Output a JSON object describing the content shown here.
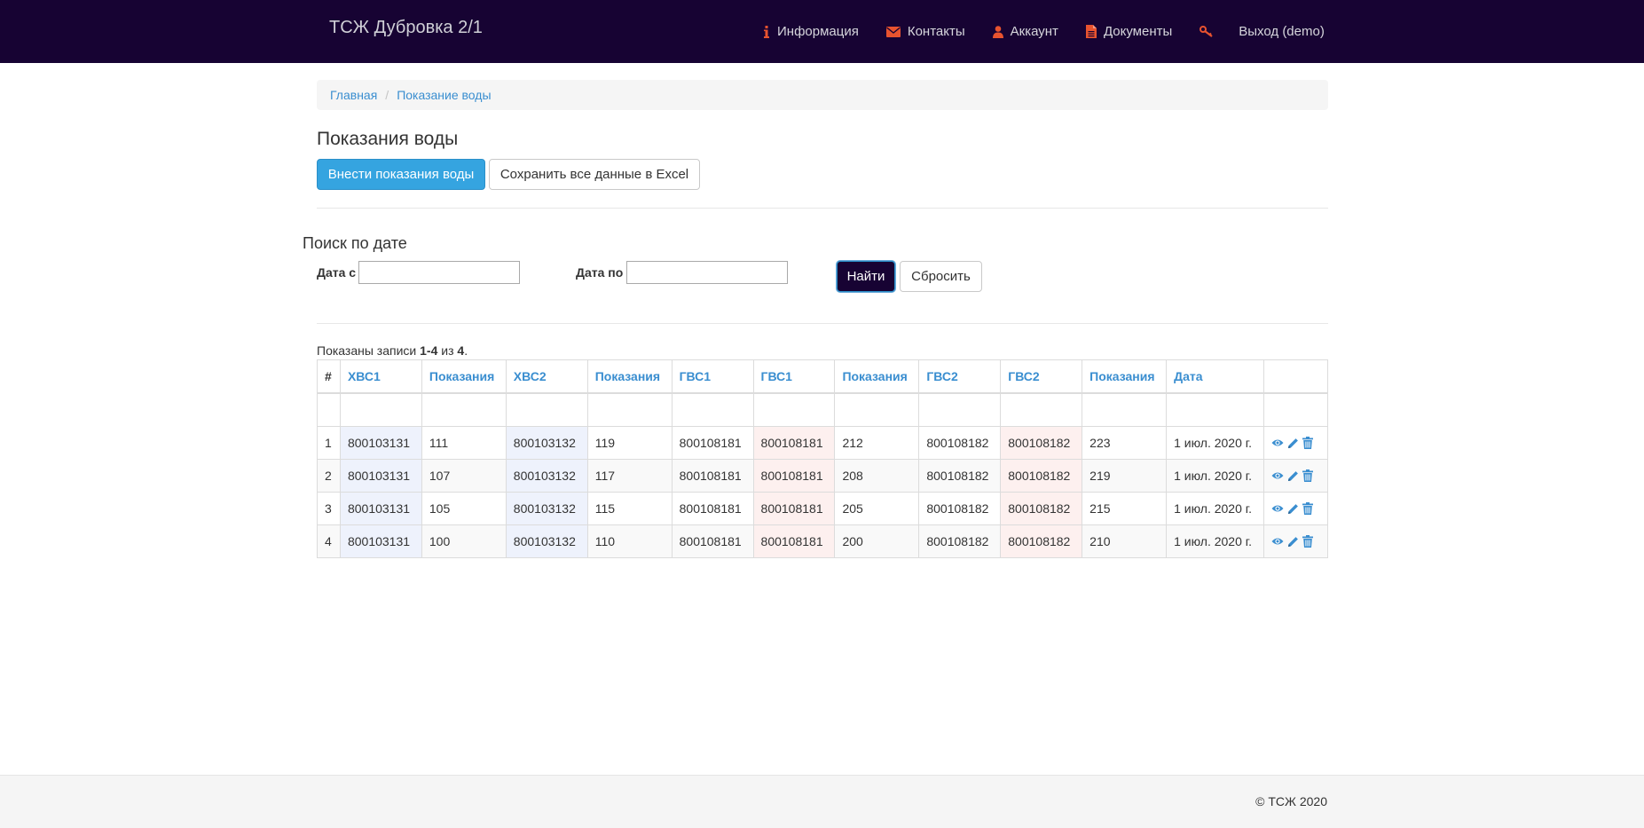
{
  "navbar": {
    "brand": "ТСЖ Дубровка 2/1",
    "items": [
      {
        "label": "Информация",
        "icon": "info-icon"
      },
      {
        "label": "Контакты",
        "icon": "envelope-icon"
      },
      {
        "label": "Аккаунт",
        "icon": "user-icon"
      },
      {
        "label": "Документы",
        "icon": "document-icon"
      },
      {
        "label": "",
        "icon": "key-icon"
      },
      {
        "label": "Выход (demo)",
        "icon": ""
      }
    ],
    "accent_color": "#e8532f",
    "background": "#170333"
  },
  "breadcrumb": {
    "home": "Главная",
    "current": "Показание воды",
    "separator": "/"
  },
  "page": {
    "title": "Показания воды",
    "add_button": "Внести показания воды",
    "export_button": "Сохранить все данные в Excel"
  },
  "search": {
    "title": "Поиск по дате",
    "date_from_label": "Дата с",
    "date_from_value": "",
    "date_to_label": "Дата по",
    "date_to_value": "",
    "find_button": "Найти",
    "reset_button": "Сбросить"
  },
  "summary": {
    "prefix": "Показаны записи",
    "range": "1-4",
    "of": "из",
    "total": "4",
    "suffix": "."
  },
  "table": {
    "columns": [
      "#",
      "ХВС1",
      "Показания",
      "ХВС2",
      "Показания",
      "ГВС1",
      "ГВС1",
      "Показания",
      "ГВС2",
      "ГВС2",
      "Показания",
      "Дата",
      ""
    ],
    "rows": [
      [
        "1",
        "800103131",
        "111",
        "800103132",
        "119",
        "800108181",
        "800108181",
        "212",
        "800108182",
        "800108182",
        "223",
        "1 июл. 2020 г."
      ],
      [
        "2",
        "800103131",
        "107",
        "800103132",
        "117",
        "800108181",
        "800108181",
        "208",
        "800108182",
        "800108182",
        "219",
        "1 июл. 2020 г."
      ],
      [
        "3",
        "800103131",
        "105",
        "800103132",
        "115",
        "800108181",
        "800108181",
        "205",
        "800108182",
        "800108182",
        "215",
        "1 июл. 2020 г."
      ],
      [
        "4",
        "800103131",
        "100",
        "800103132",
        "110",
        "800108181",
        "800108181",
        "200",
        "800108182",
        "800108182",
        "210",
        "1 июл. 2020 г."
      ]
    ],
    "row_actions": [
      "eye-icon",
      "pencil-icon",
      "trash-icon"
    ],
    "link_color": "#3a8ed0"
  },
  "footer": {
    "copyright": "© ТСЖ 2020"
  }
}
